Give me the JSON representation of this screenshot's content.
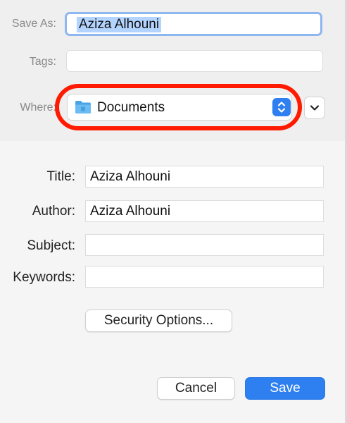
{
  "form": {
    "save_as_label": "Save As:",
    "save_as_value": "Aziza Alhouni",
    "tags_label": "Tags:",
    "tags_value": "",
    "where_label": "Where:",
    "where_value": "Documents",
    "where_icon": "folder-icon"
  },
  "metadata": {
    "title_label": "Title:",
    "title_value": "Aziza Alhouni",
    "author_label": "Author:",
    "author_value": "Aziza Alhouni",
    "subject_label": "Subject:",
    "subject_value": "",
    "keywords_label": "Keywords:",
    "keywords_value": ""
  },
  "buttons": {
    "security_options": "Security Options...",
    "cancel": "Cancel",
    "save": "Save"
  },
  "colors": {
    "accent": "#2e80f0",
    "highlight_ring": "#ff1a00",
    "selection": "#b3d4ff"
  }
}
